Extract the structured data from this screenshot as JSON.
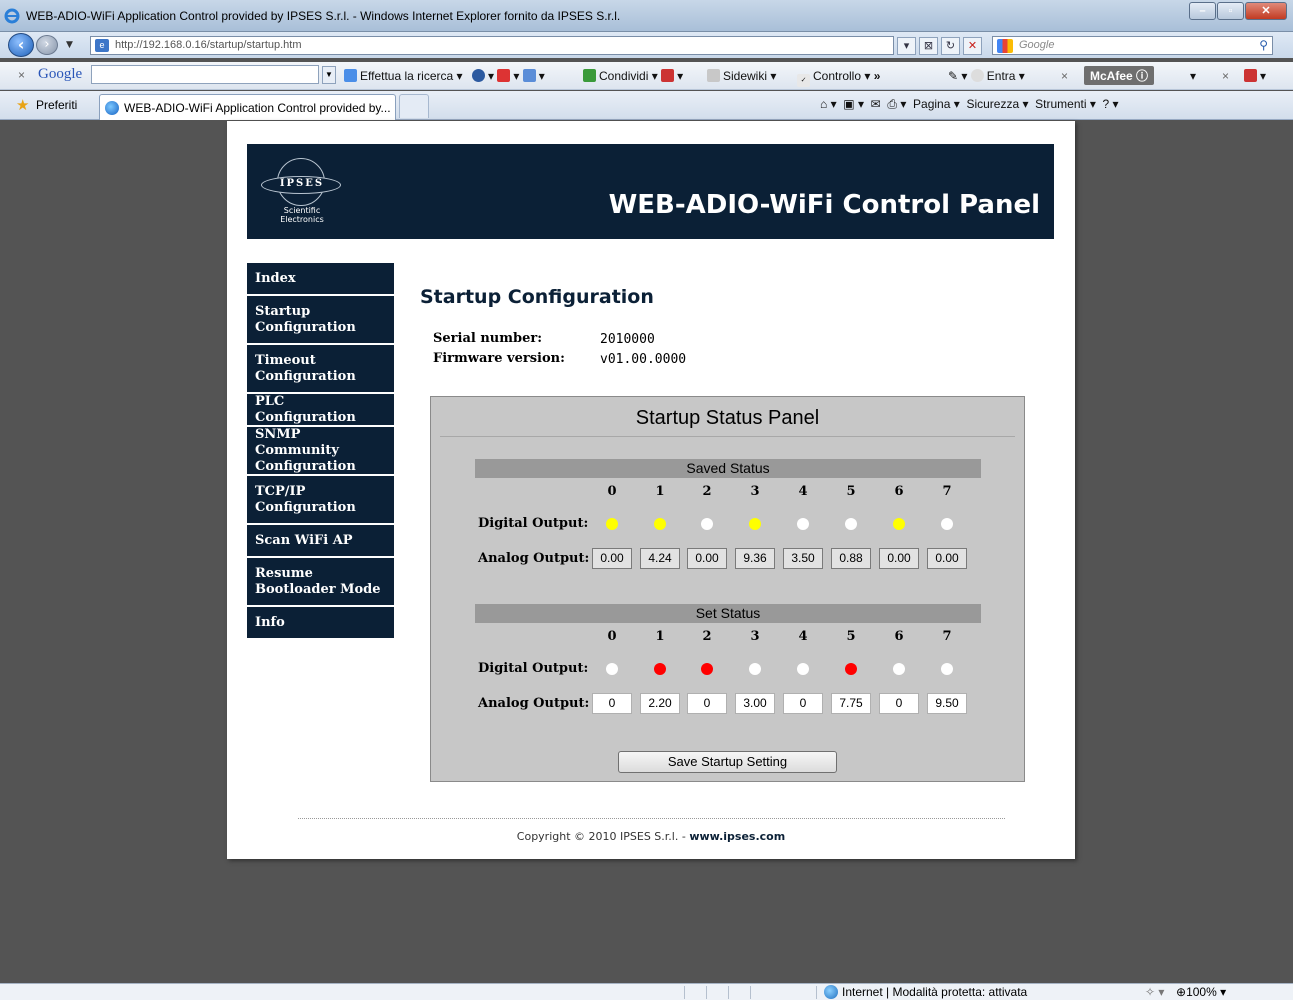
{
  "browser": {
    "window_title": "WEB-ADIO-WiFi Application Control provided by IPSES S.r.l. - Windows Internet Explorer fornito da IPSES S.r.l.",
    "address": "http://192.168.0.16/startup/startup.htm",
    "search_placeholder": "Google",
    "google_bar": {
      "label": "Google",
      "search": "Effettua la ricerca",
      "share": "Condividi",
      "sidewiki": "Sidewiki",
      "spell": "Controllo",
      "more": "»",
      "signin": "Entra",
      "mcafee": "McAfee"
    },
    "favorites": "Preferiti",
    "tab_title": "WEB-ADIO-WiFi Application Control provided by...",
    "commands": {
      "page": "Pagina",
      "security": "Sicurezza",
      "tools": "Strumenti"
    },
    "status_zone": "Internet | Modalità protetta: attivata",
    "zoom": "100%"
  },
  "banner": {
    "logo_text": "IPSES",
    "logo_sub1": "Scientific",
    "logo_sub2": "Electronics",
    "title": "WEB-ADIO-WiFi Control Panel"
  },
  "menu": [
    {
      "label": "Index"
    },
    {
      "label": "Startup Configuration"
    },
    {
      "label": "Timeout Configuration"
    },
    {
      "label": "PLC Configuration"
    },
    {
      "label": "SNMP Community Configuration"
    },
    {
      "label": "TCP/IP Configuration"
    },
    {
      "label": "Scan WiFi AP"
    },
    {
      "label": "Resume Bootloader Mode"
    },
    {
      "label": "Info"
    }
  ],
  "content": {
    "title": "Startup Configuration",
    "serial_label": "Serial number:",
    "serial_value": "2010000",
    "firmware_label": "Firmware version:",
    "firmware_value": "v01.00.0000"
  },
  "panel": {
    "title": "Startup Status Panel",
    "channels": [
      "0",
      "1",
      "2",
      "3",
      "4",
      "5",
      "6",
      "7"
    ],
    "digital_label": "Digital Output:",
    "analog_label": "Analog Output:",
    "saved": {
      "title": "Saved Status",
      "digital": [
        "yellow",
        "yellow",
        "white",
        "yellow",
        "white",
        "white",
        "yellow",
        "white"
      ],
      "analog": [
        "0.00",
        "4.24",
        "0.00",
        "9.36",
        "3.50",
        "0.88",
        "0.00",
        "0.00"
      ]
    },
    "set": {
      "title": "Set Status",
      "digital": [
        "white",
        "red",
        "red",
        "white",
        "white",
        "red",
        "white",
        "white"
      ],
      "analog": [
        "0",
        "2.20",
        "0",
        "3.00",
        "0",
        "7.75",
        "0",
        "9.50"
      ]
    },
    "save_button": "Save Startup Setting"
  },
  "footer": {
    "copyright": "Copyright © 2010 IPSES S.r.l. - ",
    "link": "www.ipses.com"
  }
}
